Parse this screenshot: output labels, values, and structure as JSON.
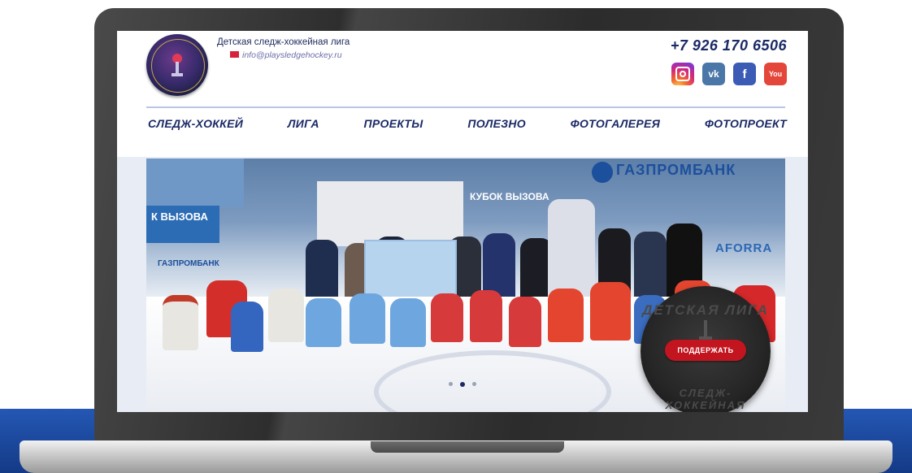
{
  "site": {
    "title": "Детская следж-хоккейная лига",
    "email": "info@playsledgehockey.ru",
    "phone": "+7 926 170 6506"
  },
  "socials": [
    {
      "name": "instagram-icon",
      "glyph": "",
      "color": "#d62976"
    },
    {
      "name": "vk-icon",
      "glyph": "vk",
      "color": "#4a76a8"
    },
    {
      "name": "facebook-icon",
      "glyph": "f",
      "color": "#3b5bb5"
    },
    {
      "name": "youtube-icon",
      "glyph": "You",
      "color": "#e4463a"
    }
  ],
  "nav": {
    "items": [
      "СЛЕДЖ-ХОККЕЙ",
      "ЛИГА",
      "ПРОЕКТЫ",
      "ПОЛЕЗНО",
      "ФОТОГАЛЕРЕЯ",
      "ФОТОПРОЕКТ"
    ]
  },
  "hero": {
    "banner_left": "К ВЫЗОВА",
    "banner_mid": "КУБОК ВЫЗОВА",
    "sponsor_main": "ГАЗПРОМБАНК",
    "sponsor_small": "ГАЗПРОМБАНК",
    "sponsor_right": "AFORRA",
    "slides": 3,
    "active_slide": 2
  },
  "support": {
    "puck_top": "ДЕТСКАЯ ЛИГА",
    "puck_bottom": "СЛЕДЖ-ХОККЕЙНАЯ",
    "button_label": "ПОДДЕРЖАТЬ"
  },
  "colors": {
    "brand_navy": "#1b2a66",
    "accent_red": "#c2151f",
    "band_blue": "#2457b4"
  }
}
